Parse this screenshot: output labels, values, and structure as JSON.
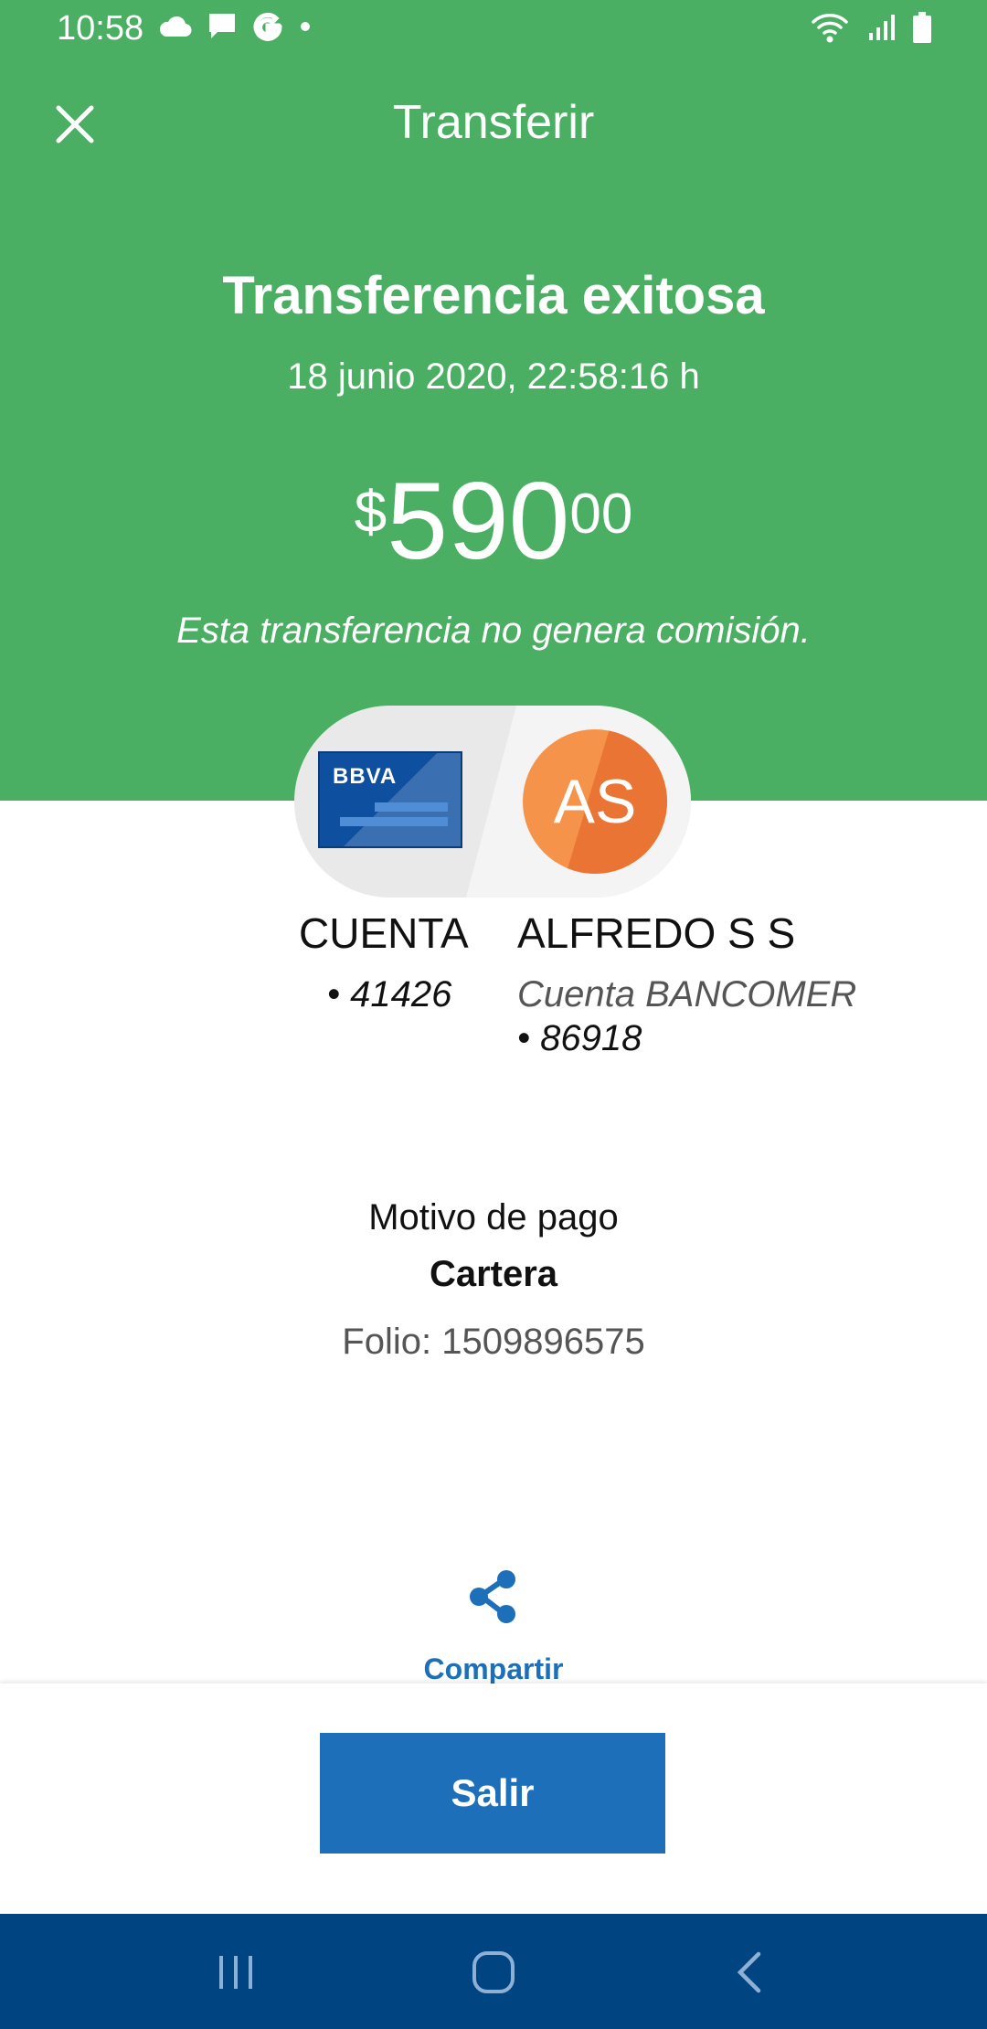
{
  "status_bar": {
    "time": "10:58",
    "left_icons": [
      "cloud-icon",
      "message-icon",
      "google-icon",
      "dot-icon"
    ],
    "right_icons": [
      "wifi-icon",
      "signal-icon",
      "battery-icon"
    ]
  },
  "header": {
    "title": "Transferir",
    "close_icon": "close-icon"
  },
  "result": {
    "title": "Transferencia exitosa",
    "datetime": "18 junio 2020, 22:58:16 h",
    "amount_currency": "$",
    "amount_integer": "590",
    "amount_decimals": "00",
    "fee_note": "Esta transferencia no genera comisión."
  },
  "origin": {
    "card_brand": "BBVA",
    "name": "CUENTA",
    "account": "• 41426"
  },
  "destination": {
    "initials": "AS",
    "name": "ALFREDO S S",
    "bank": "Cuenta BANCOMER",
    "account": "• 86918"
  },
  "details": {
    "motivo_label": "Motivo de pago",
    "motivo_value": "Cartera",
    "folio": "Folio: 1509896575"
  },
  "actions": {
    "share_label": "Compartir",
    "exit_label": "Salir"
  },
  "nav": {
    "items": [
      "recent-apps-icon",
      "home-icon",
      "back-icon"
    ]
  },
  "colors": {
    "header_green": "#4aaf63",
    "primary_blue": "#1c6fb8",
    "nav_blue": "#004481",
    "avatar_orange": "#f6934b"
  }
}
